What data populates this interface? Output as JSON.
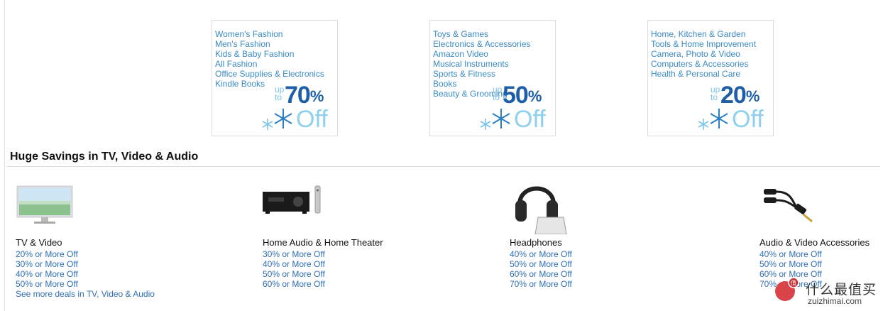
{
  "promos": [
    {
      "links": [
        "Women's Fashion",
        "Men's Fashion",
        "Kids & Baby Fashion",
        "All Fashion",
        "Office Supplies & Electronics",
        "Kindle Books"
      ],
      "up_to": "up to",
      "percent": "70",
      "percent_sign": "%",
      "off": "Off"
    },
    {
      "links": [
        "Toys & Games",
        "Electronics & Accessories",
        "Amazon Video",
        "Musical Instruments",
        "Sports & Fitness",
        "Books",
        "Beauty & Grooming"
      ],
      "up_to": "up to",
      "percent": "50",
      "percent_sign": "%",
      "off": "Off"
    },
    {
      "links": [
        "Home, Kitchen & Garden",
        "Tools & Home Improvement",
        "Camera, Photo & Video",
        "Computers & Accessories",
        "Health & Personal Care"
      ],
      "up_to": "up to",
      "percent": "20",
      "percent_sign": "%",
      "off": "Off"
    }
  ],
  "section": {
    "title": "Huge Savings in TV, Video & Audio"
  },
  "categories": [
    {
      "title": "TV & Video",
      "icon": "tv-icon",
      "deals": [
        "20% or More Off",
        "30% or More Off",
        "40% or More Off",
        "50% or More Off",
        "See more deals in TV, Video & Audio"
      ]
    },
    {
      "title": "Home Audio & Home Theater",
      "icon": "av-receiver-icon",
      "deals": [
        "30% or More Off",
        "40% or More Off",
        "50% or More Off",
        "60% or More Off"
      ]
    },
    {
      "title": "Headphones",
      "icon": "headphones-icon",
      "deals": [
        "40% or More Off",
        "50% or More Off",
        "60% or More Off",
        "70% or More Off"
      ]
    },
    {
      "title": "Audio & Video Accessories",
      "icon": "audio-cable-icon",
      "deals": [
        "40% or More Off",
        "50% or More Off",
        "60% or More Off",
        "70% or More Off"
      ]
    }
  ],
  "watermark": {
    "title": "什么最值买",
    "url": "zuizhimai.com",
    "badge": "值"
  },
  "colors": {
    "link": "#2f6fb5",
    "promo_link": "#3a8ac4",
    "percent": "#1f5fa8",
    "off": "#8fcff0"
  }
}
